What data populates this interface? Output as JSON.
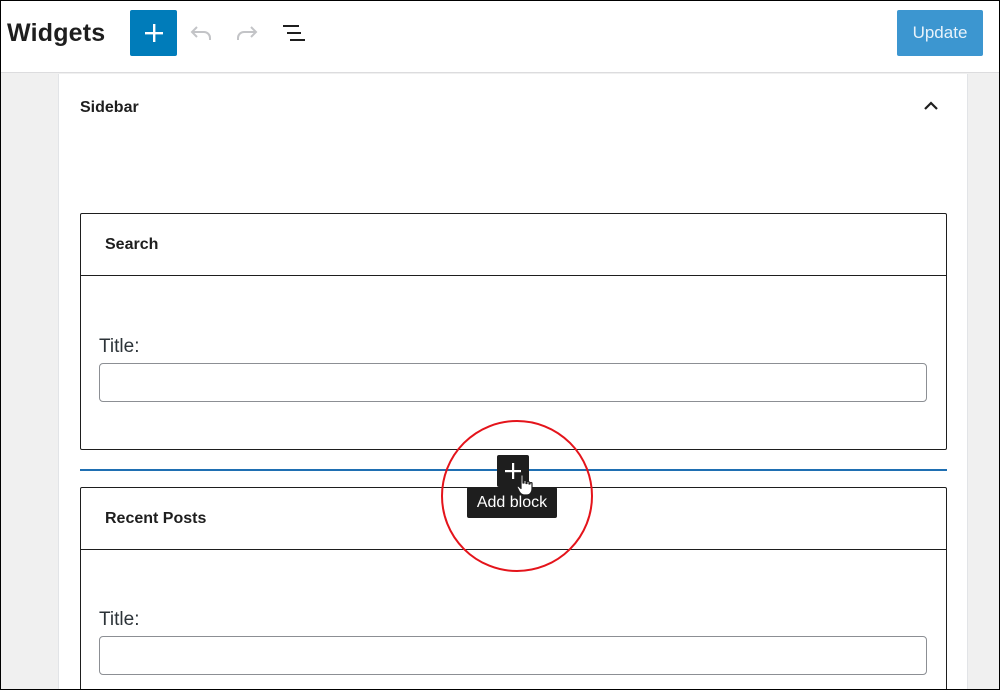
{
  "header": {
    "title": "Widgets",
    "add_icon": "plus-icon",
    "undo_icon": "undo-icon",
    "redo_icon": "redo-icon",
    "list_view_icon": "list-view-icon",
    "update_label": "Update",
    "accent_color": "#007cba"
  },
  "sidebar": {
    "title": "Sidebar",
    "collapse_icon": "chevron-up-icon",
    "widgets": [
      {
        "name": "Search",
        "field_label": "Title:",
        "field_value": ""
      },
      {
        "name": "Recent Posts",
        "field_label": "Title:",
        "field_value": ""
      }
    ]
  },
  "inserter": {
    "icon": "plus-icon",
    "tooltip": "Add block",
    "highlight_color": "#e4141b"
  }
}
